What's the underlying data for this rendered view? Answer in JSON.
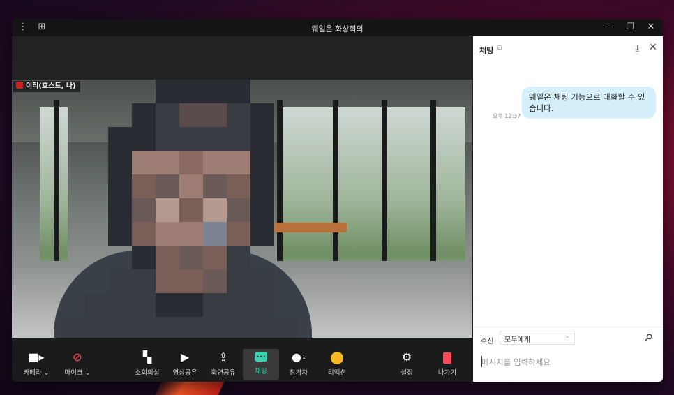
{
  "window": {
    "title": "웨일온 화상회의"
  },
  "video": {
    "participant_name": "이티(호스트, 나)"
  },
  "toolbar": {
    "camera_label": "카메라 ⌄",
    "mic_label": "마이크 ⌄",
    "breakout_label": "소회의실",
    "video_share_label": "영상공유",
    "screen_share_label": "화면공유",
    "chat_label": "채팅",
    "participants_label": "참가자",
    "participants_count": "1",
    "reaction_label": "리액션",
    "settings_label": "설정",
    "exit_label": "나가기"
  },
  "chat": {
    "title": "채팅",
    "messages": [
      {
        "time": "오후 12:37",
        "text": "웨일온 채팅 기능으로 대화할 수 있습니다."
      }
    ],
    "recipient_label": "수신",
    "recipient_value": "모두에게",
    "input_placeholder": "메시지를 입력하세요"
  },
  "colors": {
    "accent": "#3fd0b0",
    "exit": "#ff4a5a",
    "bubble": "#d6f0fb",
    "titlebar": "#141414"
  },
  "icons": {
    "menu": "kebab-icon",
    "layout": "grid-icon",
    "camera": "video-camera-icon",
    "mic": "mic-off-icon",
    "breakout": "layout-panel-icon",
    "video_share": "play-icon",
    "screen_share": "screen-upload-icon",
    "chat": "chat-bubble-icon",
    "participants": "person-icon",
    "reaction": "smile-icon",
    "settings": "gear-icon",
    "exit": "door-exit-icon"
  }
}
